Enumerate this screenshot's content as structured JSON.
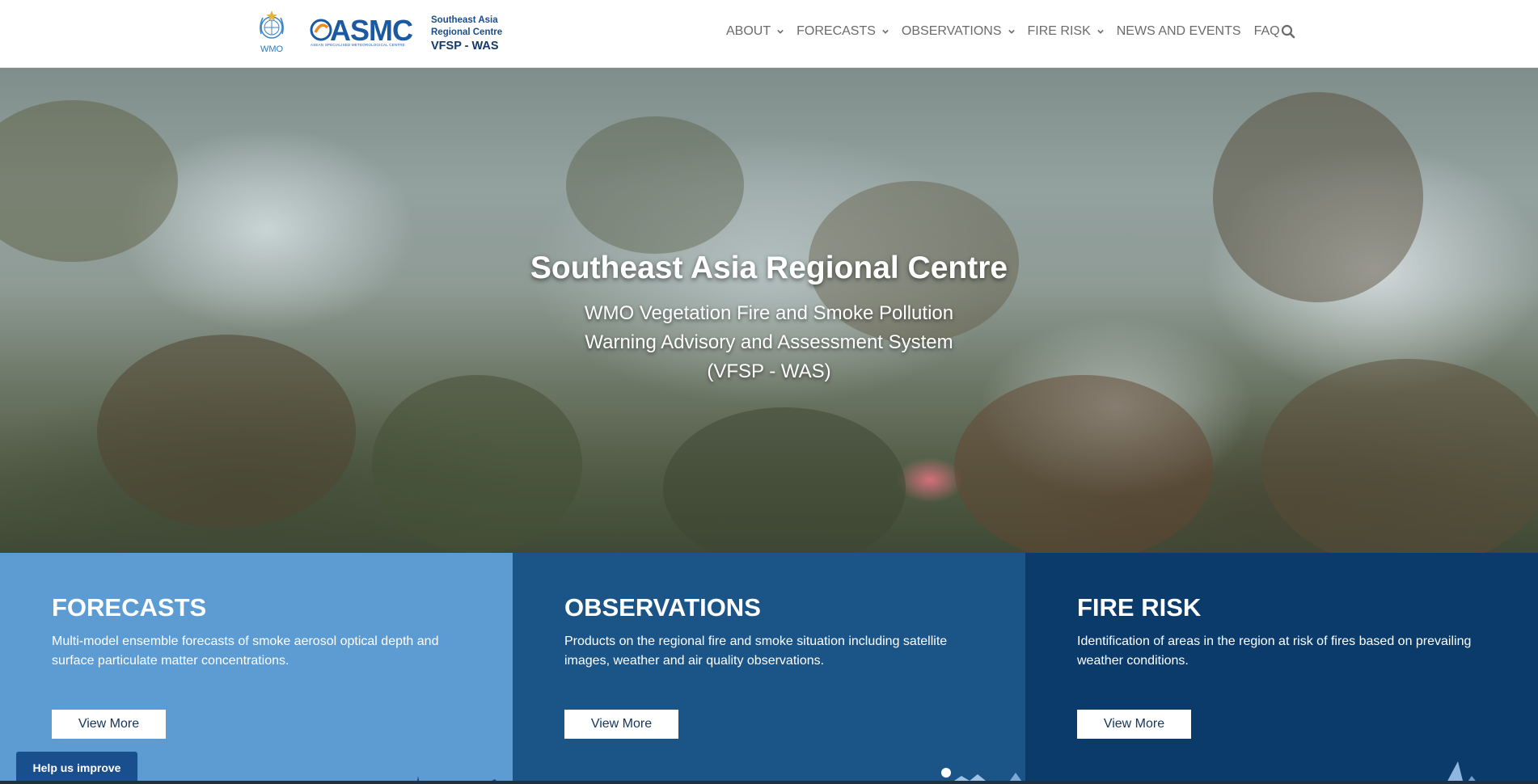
{
  "header": {
    "wmo_logo_text": "WMO",
    "asmc_logo_text": "ASMC",
    "asmc_logo_subtext": "ASEAN SPECIALISED METEOROLOGICAL CENTRE",
    "region_line1": "Southeast Asia",
    "region_line2": "Regional Centre",
    "region_line3": "VFSP - WAS",
    "nav": [
      {
        "label": "ABOUT",
        "has_dropdown": true
      },
      {
        "label": "FORECASTS",
        "has_dropdown": true
      },
      {
        "label": "OBSERVATIONS",
        "has_dropdown": true
      },
      {
        "label": "FIRE RISK",
        "has_dropdown": true
      },
      {
        "label": "NEWS AND EVENTS",
        "has_dropdown": false
      },
      {
        "label": "FAQ",
        "has_dropdown": false
      }
    ],
    "search_icon": "search-icon"
  },
  "hero": {
    "title": "Southeast Asia Regional Centre",
    "subtitle_line1": "WMO Vegetation Fire and Smoke Pollution",
    "subtitle_line2": "Warning Advisory and Assessment System",
    "subtitle_line3": "(VFSP - WAS)"
  },
  "cards": [
    {
      "title": "FORECASTS",
      "description": "Multi-model ensemble forecasts of smoke aerosol optical depth and surface particulate matter concentrations.",
      "button": "View More",
      "color": "#5d9cd3"
    },
    {
      "title": "OBSERVATIONS",
      "description": "Products on the regional fire and smoke situation including satellite images, weather and air quality observations.",
      "button": "View More",
      "color": "#1b5587"
    },
    {
      "title": "FIRE RISK",
      "description": "Identification of areas in the region at risk of fires based on prevailing weather conditions.",
      "button": "View More",
      "color": "#0a3b6a"
    }
  ],
  "feedback": {
    "label": "Help us improve"
  },
  "colors": {
    "brand_blue": "#1b5aa3",
    "nav_text": "#6b6b6b",
    "feedback_bg": "#1a4f8e"
  }
}
